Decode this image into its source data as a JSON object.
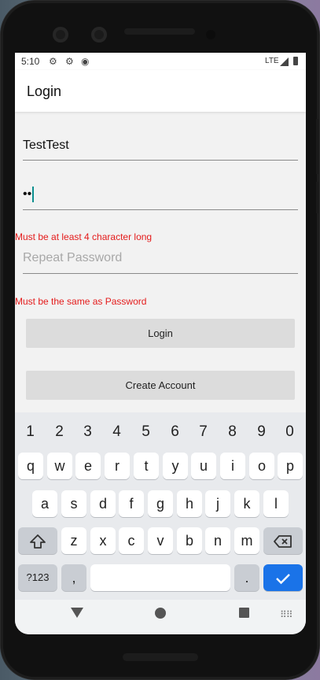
{
  "status": {
    "time": "5:10",
    "icons": [
      "gear-icon",
      "gear-icon",
      "android-icon"
    ],
    "network": "LTE"
  },
  "appbar": {
    "title": "Login"
  },
  "form": {
    "username_value": "TestTest",
    "password_value": "••",
    "password_error": "Must be at least 4 character long",
    "repeat_placeholder": "Repeat Password",
    "repeat_error": "Must be the same as Password",
    "login_label": "Login",
    "create_label": "Create Account"
  },
  "keyboard": {
    "numbers": [
      "1",
      "2",
      "3",
      "4",
      "5",
      "6",
      "7",
      "8",
      "9",
      "0"
    ],
    "row1": [
      "q",
      "w",
      "e",
      "r",
      "t",
      "y",
      "u",
      "i",
      "o",
      "p"
    ],
    "row2": [
      "a",
      "s",
      "d",
      "f",
      "g",
      "h",
      "j",
      "k",
      "l"
    ],
    "row3": [
      "z",
      "x",
      "c",
      "v",
      "b",
      "n",
      "m"
    ],
    "symbols_label": "?123",
    "comma_label": ",",
    "period_label": ".",
    "shift_icon": "shift-icon",
    "backspace_icon": "backspace-icon",
    "enter_icon": "checkmark-icon"
  },
  "navbar": {
    "icons": [
      "back-icon",
      "home-icon",
      "recents-icon",
      "keyboard-switch-icon"
    ]
  },
  "colors": {
    "error": "#e41b1b",
    "accent": "#1a73e8",
    "cursor": "#0b8f8f"
  }
}
